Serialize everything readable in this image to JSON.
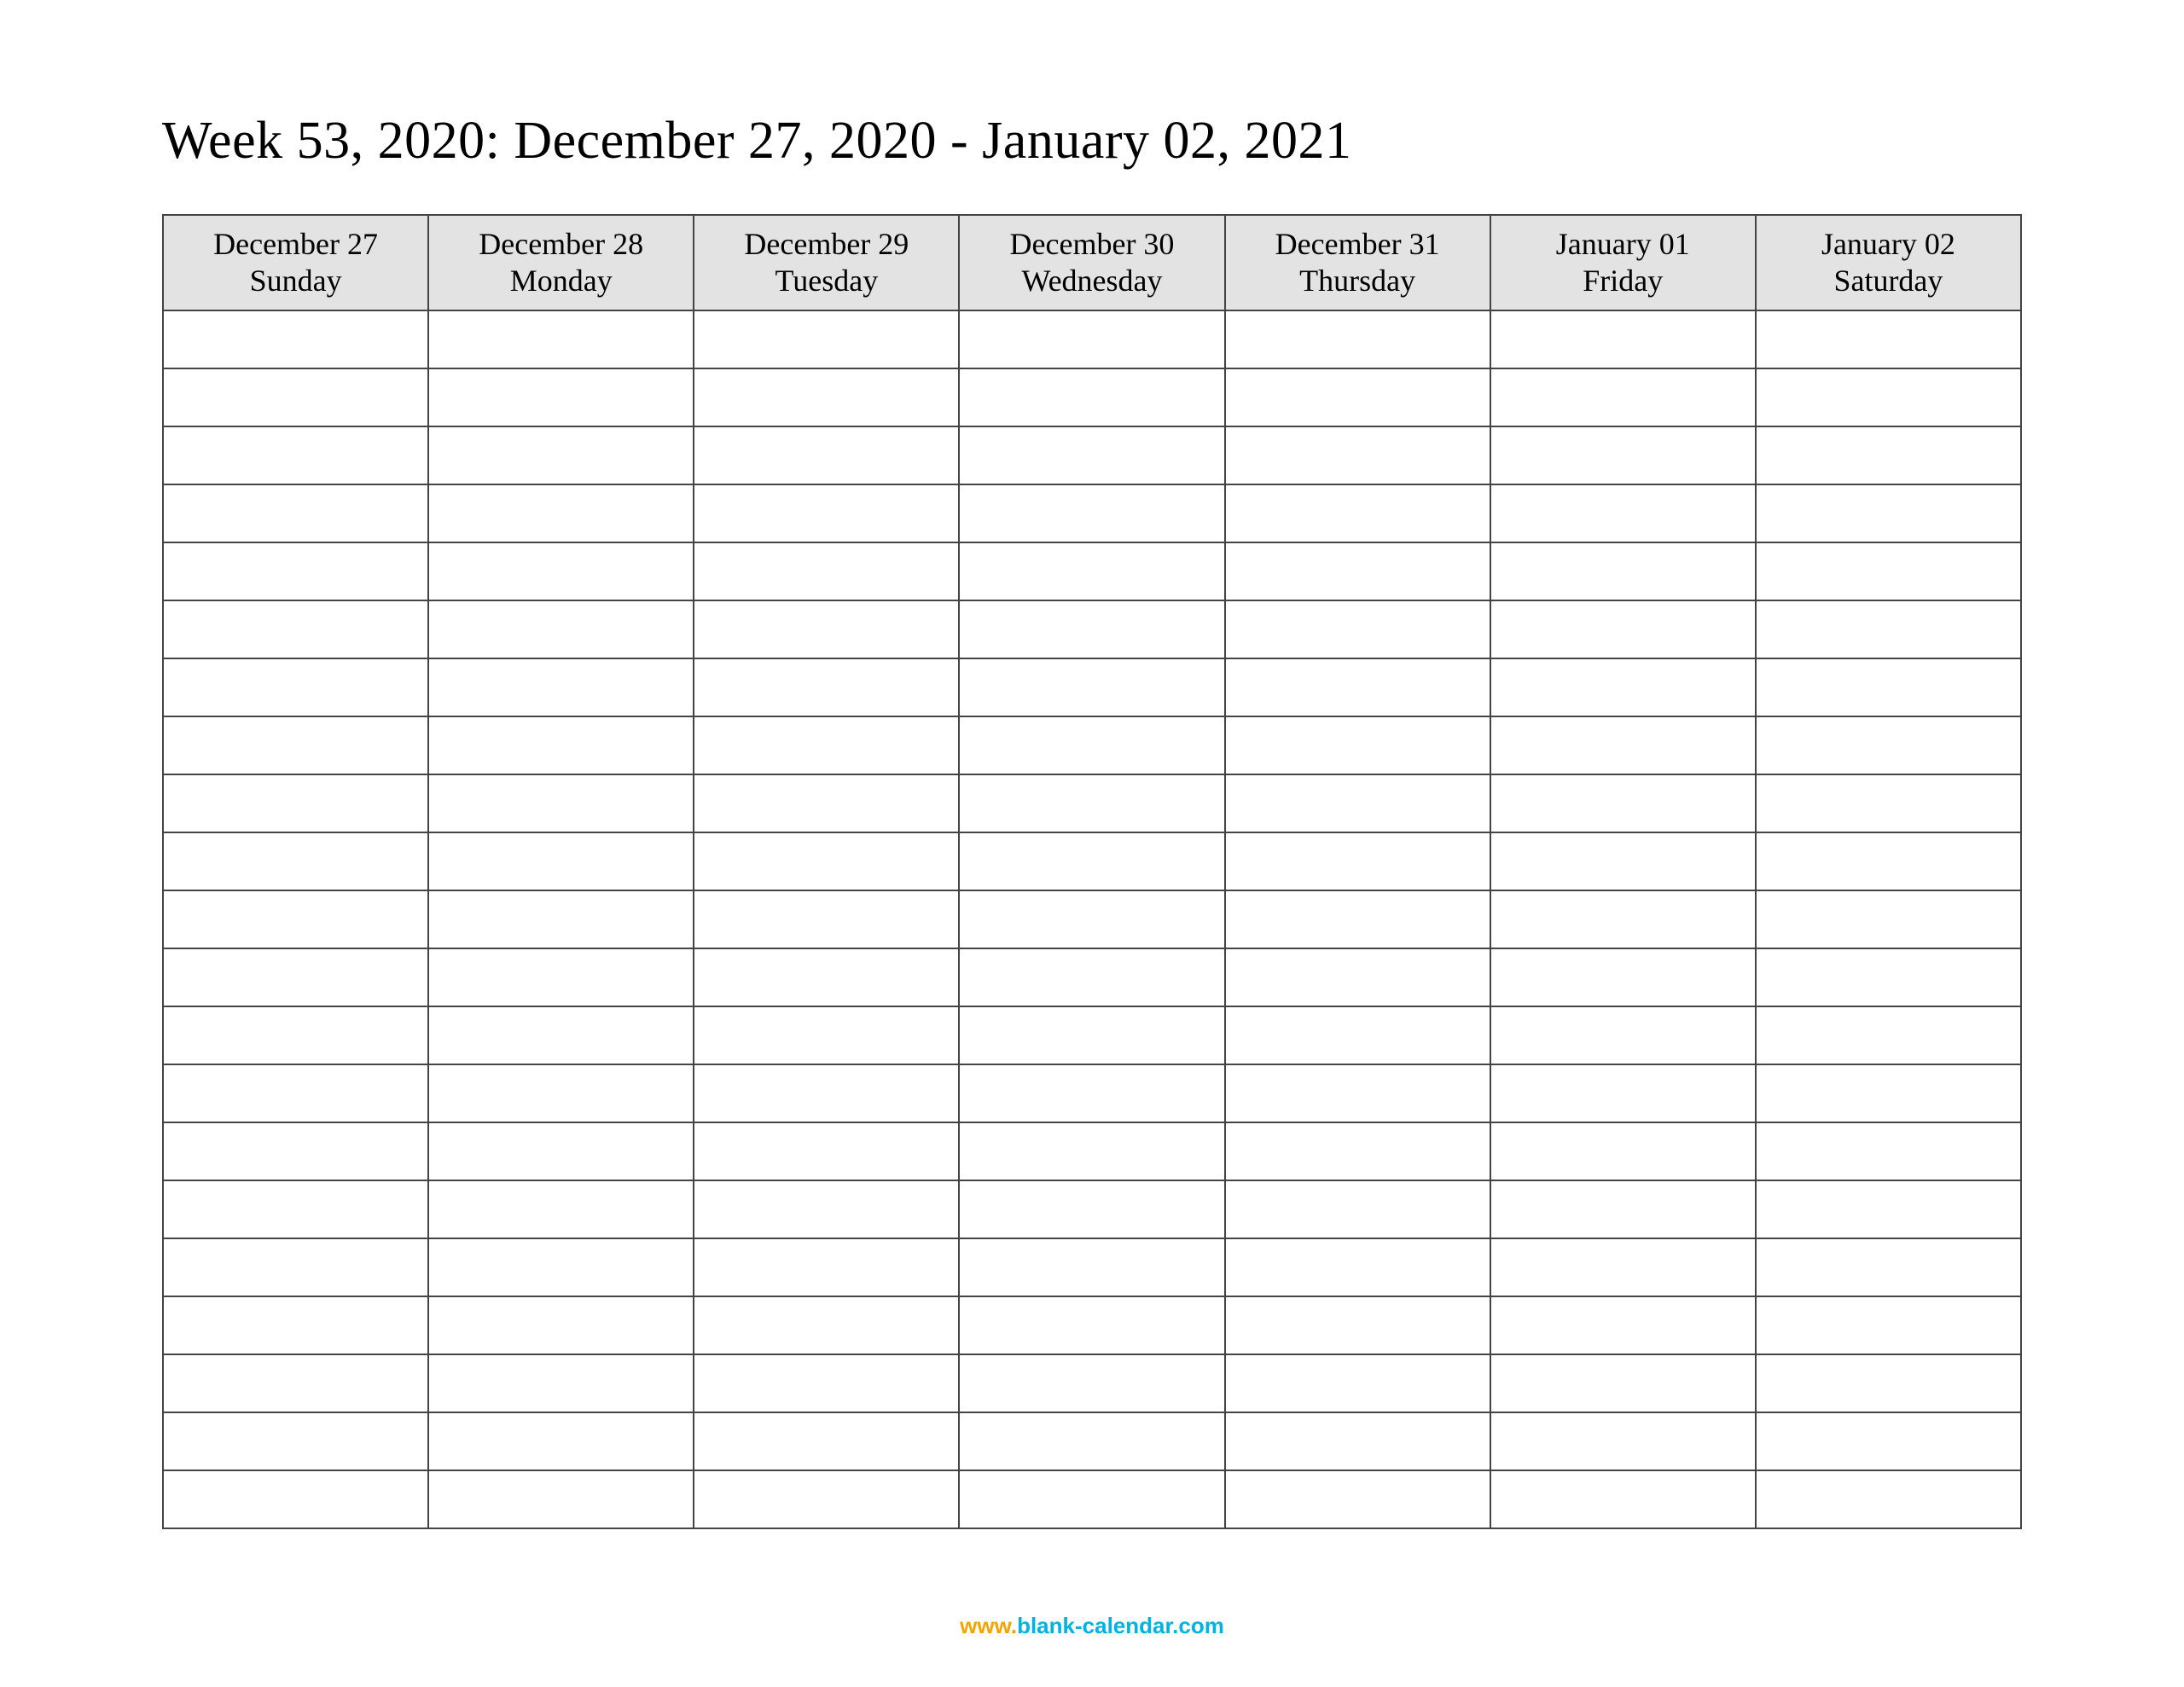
{
  "title": "Week 53, 2020: December 27, 2020 - January 02, 2021",
  "columns": [
    {
      "date": "December 27",
      "day": "Sunday"
    },
    {
      "date": "December 28",
      "day": "Monday"
    },
    {
      "date": "December 29",
      "day": "Tuesday"
    },
    {
      "date": "December 30",
      "day": "Wednesday"
    },
    {
      "date": "December 31",
      "day": "Thursday"
    },
    {
      "date": "January 01",
      "day": "Friday"
    },
    {
      "date": "January 02",
      "day": "Saturday"
    }
  ],
  "row_count": 21,
  "footer": {
    "part_a": "www.",
    "part_b": "blank-calendar.com"
  }
}
